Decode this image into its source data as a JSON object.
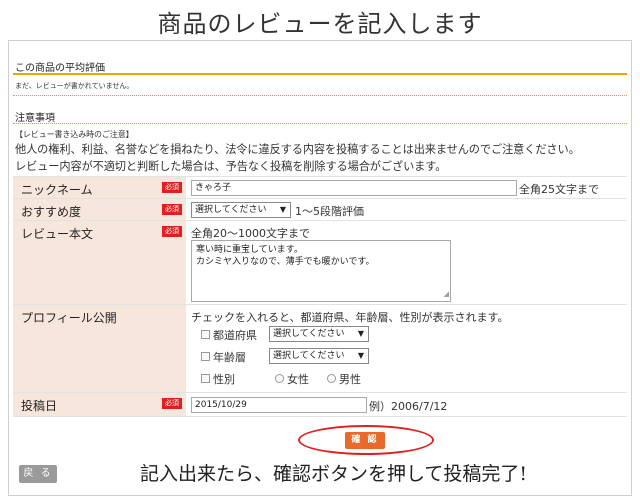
{
  "heading": "商品のレビューを記入します",
  "avg_rating": {
    "title": "この商品の平均評価",
    "message": "まだ、レビューが書かれていません。"
  },
  "notes": {
    "title": "注意事項",
    "small_title": "【レビュー書き込み時のご注意】",
    "line1": "他人の権利、利益、名誉などを損ねたり、法令に違反する内容を投稿することは出来ませんのでご注意ください。",
    "line2": "レビュー内容が不適切と判断した場合は、予告なく投稿を削除する場合がございます。"
  },
  "required_label": "必須",
  "form": {
    "nickname": {
      "label": "ニックネーム",
      "value": "きゃろ子",
      "hint": "全角25文字まで"
    },
    "rating": {
      "label": "おすすめ度",
      "selected": "選択してください",
      "hint": "1～5段階評価"
    },
    "review": {
      "label": "レビュー本文",
      "hint": "全角20～1000文字まで",
      "line1": "寒い時に重宝しています。",
      "line2": "カシミヤ入りなので、薄手でも暖かいです。"
    },
    "profile": {
      "label": "プロフィール公開",
      "hint": "チェックを入れると、都道府県、年齢層、性別が表示されます。",
      "prefecture_label": "都道府県",
      "prefecture_selected": "選択してください",
      "age_label": "年齢層",
      "age_selected": "選択してください",
      "gender_label": "性別",
      "female": "女性",
      "male": "男性"
    },
    "date": {
      "label": "投稿日",
      "value": "2015/10/29",
      "example": "例）2006/7/12"
    }
  },
  "buttons": {
    "confirm": "確 認",
    "back": "戻 る"
  },
  "caption": "記入出来たら、確認ボタンを押して投稿完了!",
  "colors": {
    "label_bg": "#f6e6dc",
    "required": "#e02020",
    "confirm_btn": "#e86a2a",
    "accent_line": "#f0a020"
  }
}
